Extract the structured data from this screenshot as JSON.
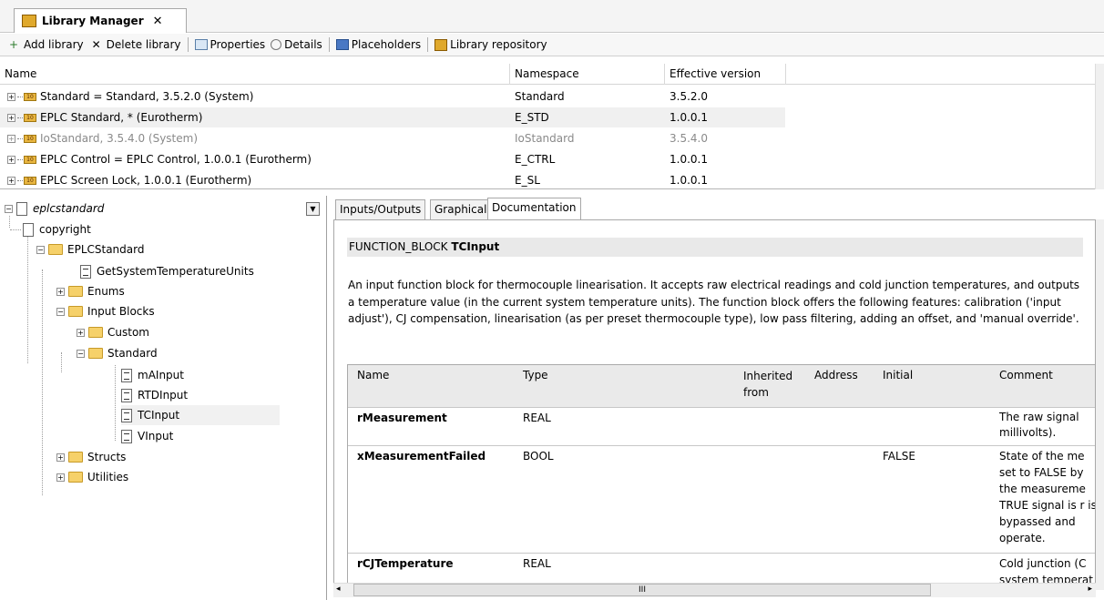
{
  "window": {
    "tab_title": "Library Manager",
    "close_glyph": "✕"
  },
  "toolbar": {
    "items": [
      {
        "label": "Add library",
        "icon": "add-library-icon"
      },
      {
        "label": "Delete library",
        "icon": "delete-icon"
      },
      {
        "label": "Properties",
        "icon": "properties-icon"
      },
      {
        "label": "Details",
        "icon": "details-icon"
      },
      {
        "label": "Placeholders",
        "icon": "placeholders-icon"
      },
      {
        "label": "Library repository",
        "icon": "library-repository-icon"
      }
    ]
  },
  "libraries": {
    "columns": [
      "Name",
      "Namespace",
      "Effective version"
    ],
    "rows": [
      {
        "name": "Standard = Standard, 3.5.2.0 (System)",
        "namespace": "Standard",
        "version": "3.5.2.0",
        "greyed": false
      },
      {
        "name": "EPLC Standard, * (Eurotherm)",
        "namespace": "E_STD",
        "version": "1.0.0.1",
        "greyed": false
      },
      {
        "name": "IoStandard, 3.5.4.0 (System)",
        "namespace": "IoStandard",
        "version": "3.5.4.0",
        "greyed": true
      },
      {
        "name": "EPLC Control = EPLC Control, 1.0.0.1 (Eurotherm)",
        "namespace": "E_CTRL",
        "version": "1.0.0.1",
        "greyed": false
      },
      {
        "name": "EPLC Screen Lock, 1.0.0.1 (Eurotherm)",
        "namespace": "E_SL",
        "version": "1.0.0.1",
        "greyed": false
      }
    ]
  },
  "tree": {
    "root": "eplcstandard",
    "nodes": [
      "copyright",
      "EPLCStandard",
      "GetSystemTemperatureUnits",
      "Enums",
      "Input Blocks",
      "Custom",
      "Standard",
      "mAInput",
      "RTDInput",
      "TCInput",
      "VInput",
      "Structs",
      "Utilities"
    ]
  },
  "tabs": [
    "Inputs/Outputs",
    "Graphical",
    "Documentation"
  ],
  "doc": {
    "fb_prefix": "FUNCTION_BLOCK ",
    "fb_name": "TCInput",
    "description": "An input function block for thermocouple linearisation. It accepts raw electrical readings and cold junction temperatures, and outputs a temperature value (in the current system temperature units). The function block offers the following features: calibration ('input adjust'), CJ compensation, linearisation (as per preset thermocouple type), low pass filtering, adding an offset, and 'manual override'.",
    "columns": [
      "Name",
      "Type",
      "Inherited from",
      "Address",
      "Initial",
      "Comment"
    ],
    "rows": [
      {
        "name": "rMeasurement",
        "type": "REAL",
        "initial": "",
        "comment": "The raw signal millivolts)."
      },
      {
        "name": "xMeasurementFailed",
        "type": "BOOL",
        "initial": "FALSE",
        "comment": "State of the me set to FALSE by the measureme TRUE signal is r is bypassed and operate."
      },
      {
        "name": "rCJTemperature",
        "type": "REAL",
        "initial": "",
        "comment": "Cold junction (C system temperat"
      }
    ]
  },
  "scroll": {
    "h_glyph": "III"
  }
}
